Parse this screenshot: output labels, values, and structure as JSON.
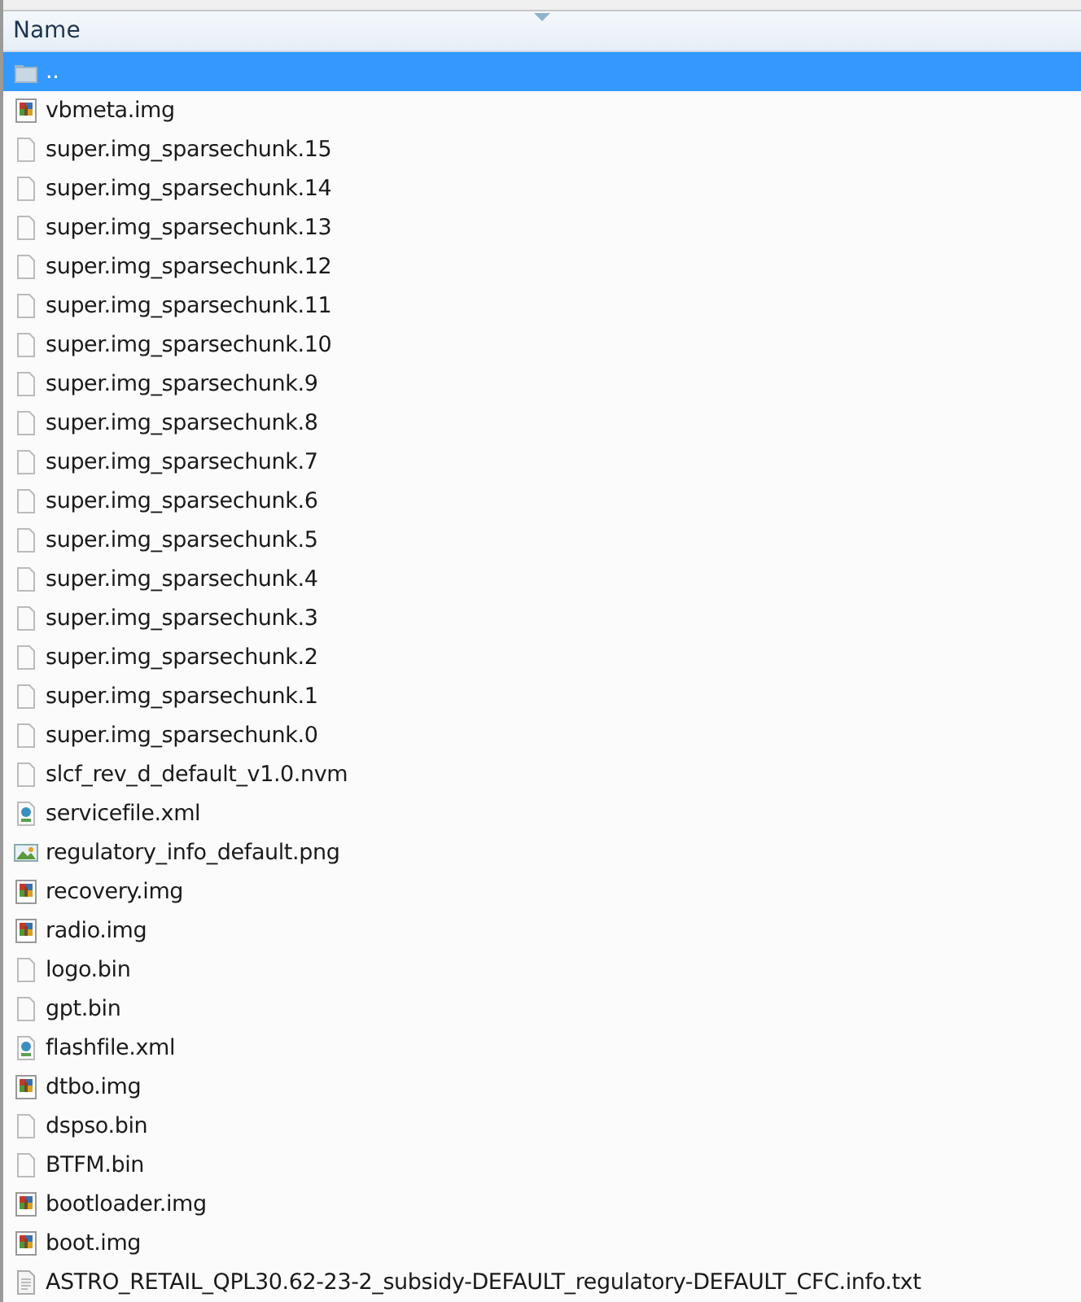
{
  "columns": [
    {
      "label": "Name",
      "sorted": true
    }
  ],
  "rows": [
    {
      "name": "..",
      "kind": "folder",
      "selected": true
    },
    {
      "name": "vbmeta.img",
      "kind": "archive",
      "selected": false
    },
    {
      "name": "super.img_sparsechunk.15",
      "kind": "blank",
      "selected": false
    },
    {
      "name": "super.img_sparsechunk.14",
      "kind": "blank",
      "selected": false
    },
    {
      "name": "super.img_sparsechunk.13",
      "kind": "blank",
      "selected": false
    },
    {
      "name": "super.img_sparsechunk.12",
      "kind": "blank",
      "selected": false
    },
    {
      "name": "super.img_sparsechunk.11",
      "kind": "blank",
      "selected": false
    },
    {
      "name": "super.img_sparsechunk.10",
      "kind": "blank",
      "selected": false
    },
    {
      "name": "super.img_sparsechunk.9",
      "kind": "blank",
      "selected": false
    },
    {
      "name": "super.img_sparsechunk.8",
      "kind": "blank",
      "selected": false
    },
    {
      "name": "super.img_sparsechunk.7",
      "kind": "blank",
      "selected": false
    },
    {
      "name": "super.img_sparsechunk.6",
      "kind": "blank",
      "selected": false
    },
    {
      "name": "super.img_sparsechunk.5",
      "kind": "blank",
      "selected": false
    },
    {
      "name": "super.img_sparsechunk.4",
      "kind": "blank",
      "selected": false
    },
    {
      "name": "super.img_sparsechunk.3",
      "kind": "blank",
      "selected": false
    },
    {
      "name": "super.img_sparsechunk.2",
      "kind": "blank",
      "selected": false
    },
    {
      "name": "super.img_sparsechunk.1",
      "kind": "blank",
      "selected": false
    },
    {
      "name": "super.img_sparsechunk.0",
      "kind": "blank",
      "selected": false
    },
    {
      "name": "slcf_rev_d_default_v1.0.nvm",
      "kind": "blank",
      "selected": false
    },
    {
      "name": "servicefile.xml",
      "kind": "xml",
      "selected": false
    },
    {
      "name": "regulatory_info_default.png",
      "kind": "image",
      "selected": false
    },
    {
      "name": "recovery.img",
      "kind": "archive",
      "selected": false
    },
    {
      "name": "radio.img",
      "kind": "archive",
      "selected": false
    },
    {
      "name": "logo.bin",
      "kind": "blank",
      "selected": false
    },
    {
      "name": "gpt.bin",
      "kind": "blank",
      "selected": false
    },
    {
      "name": "flashfile.xml",
      "kind": "xml",
      "selected": false
    },
    {
      "name": "dtbo.img",
      "kind": "archive",
      "selected": false
    },
    {
      "name": "dspso.bin",
      "kind": "blank",
      "selected": false
    },
    {
      "name": "BTFM.bin",
      "kind": "blank",
      "selected": false
    },
    {
      "name": "bootloader.img",
      "kind": "archive",
      "selected": false
    },
    {
      "name": "boot.img",
      "kind": "archive",
      "selected": false
    },
    {
      "name": "ASTRO_RETAIL_QPL30.62-23-2_subsidy-DEFAULT_regulatory-DEFAULT_CFC.info.txt",
      "kind": "text",
      "selected": false
    }
  ]
}
